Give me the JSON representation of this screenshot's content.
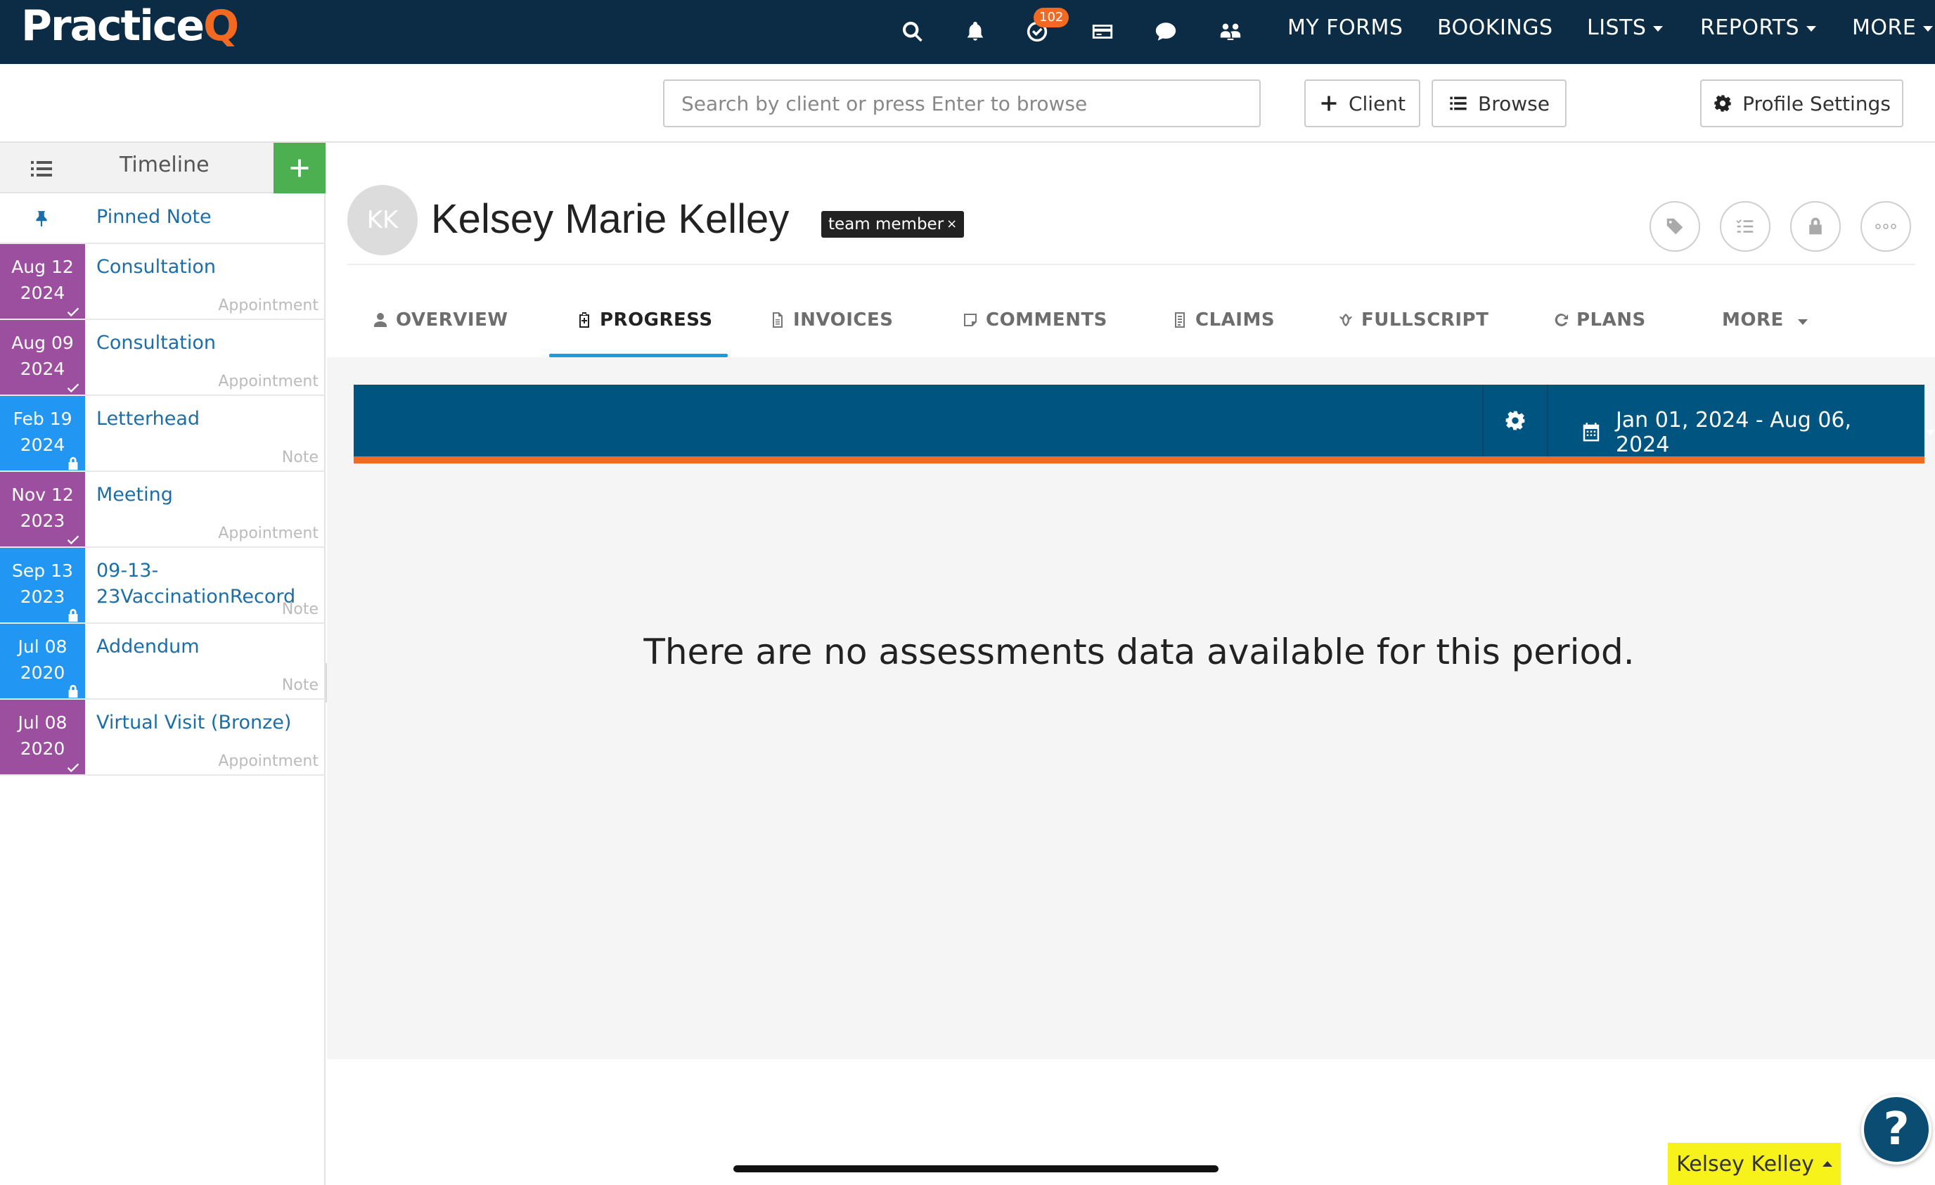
{
  "brand": {
    "logo_main": "Practice",
    "logo_accent": "Q"
  },
  "topnav": {
    "badge_count": "102",
    "links": [
      "MY FORMS",
      "BOOKINGS",
      "LISTS",
      "REPORTS",
      "MORE"
    ]
  },
  "subbar": {
    "search_placeholder": "Search by client or press Enter to browse",
    "client_button": "Client",
    "browse_button": "Browse",
    "profile_button": "Profile Settings"
  },
  "sidebar": {
    "title": "Timeline",
    "pinned_label": "Pinned Note",
    "items": [
      {
        "month": "Aug 12",
        "year": "2024",
        "title": "Consultation",
        "type": "Appointment",
        "color": "purple",
        "mark": "check"
      },
      {
        "month": "Aug 09",
        "year": "2024",
        "title": "Consultation",
        "type": "Appointment",
        "color": "purple",
        "mark": "check"
      },
      {
        "month": "Feb 19",
        "year": "2024",
        "title": "Letterhead",
        "type": "Note",
        "color": "blue",
        "mark": "lock"
      },
      {
        "month": "Nov 12",
        "year": "2023",
        "title": "Meeting",
        "type": "Appointment",
        "color": "purple",
        "mark": "check"
      },
      {
        "month": "Sep 13",
        "year": "2023",
        "title": "09-13-23VaccinationRecord",
        "type": "Note",
        "color": "blue",
        "mark": "lock"
      },
      {
        "month": "Jul 08",
        "year": "2020",
        "title": "Addendum",
        "type": "Note",
        "color": "blue",
        "mark": "lock"
      },
      {
        "month": "Jul 08",
        "year": "2020",
        "title": "Virtual Visit (Bronze)",
        "type": "Appointment",
        "color": "purple",
        "mark": "check"
      }
    ]
  },
  "client": {
    "initials": "KK",
    "name": "Kelsey Marie Kelley",
    "tag": "team member",
    "tag_remove": "×"
  },
  "tabs": [
    {
      "label": "OVERVIEW",
      "icon": "user-icon"
    },
    {
      "label": "PROGRESS",
      "icon": "clipboard-plus-icon",
      "active": true
    },
    {
      "label": "INVOICES",
      "icon": "document-icon"
    },
    {
      "label": "COMMENTS",
      "icon": "note-icon"
    },
    {
      "label": "CLAIMS",
      "icon": "claims-icon"
    },
    {
      "label": "FULLSCRIPT",
      "icon": "leaf-icon"
    },
    {
      "label": "PLANS",
      "icon": "refresh-icon"
    },
    {
      "label": "MORE",
      "icon": "caret-down-icon"
    }
  ],
  "progress": {
    "date_range": "Jan 01, 2024 - Aug 06, 2024",
    "empty_message": "There are no assessments data available for this period."
  },
  "footer": {
    "user_name": "Kelsey Kelley",
    "help_label": "?"
  },
  "colors": {
    "nav_bg": "#0b2c44",
    "accent_orange": "#f26a21",
    "toolbar_blue": "#005580",
    "tab_underline": "#1e9be0",
    "appointment_purple": "#9c4f9e",
    "note_blue": "#2196f3",
    "add_green": "#4caf50",
    "user_chip_yellow": "#f6f21a"
  }
}
